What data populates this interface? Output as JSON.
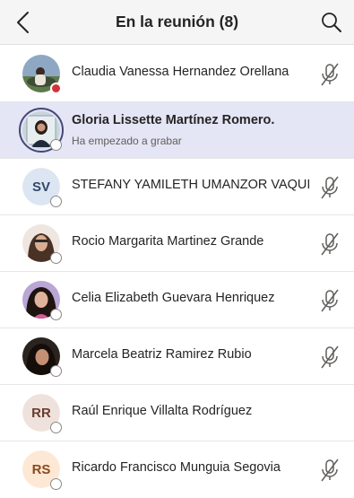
{
  "header": {
    "title": "En la reunión (8)",
    "back_icon": "chevron-left-icon",
    "search_icon": "search-icon"
  },
  "colors": {
    "header_bg": "#f5f5f5",
    "highlight_bg": "#e4e5f5",
    "busy": "#d13438",
    "presenter_ring": "#464775"
  },
  "participants": [
    {
      "name": "Claudia Vanessa  Hernandez Orellana",
      "avatar": "photo",
      "presence": "busy",
      "muted": true
    },
    {
      "name": "Gloria Lissette Martínez Romero.",
      "subtitle": "Ha empezado a grabar",
      "avatar": "photo",
      "presence": "offline",
      "muted": false,
      "highlighted": true
    },
    {
      "name": "STEFANY YAMILETH UMANZOR VAQUIZ",
      "initials": "SV",
      "avatar": "initials",
      "presence": "offline",
      "muted": true
    },
    {
      "name": "Rocio Margarita Martinez Grande",
      "avatar": "photo",
      "presence": "offline",
      "muted": true
    },
    {
      "name": "Celia Elizabeth Guevara Henriquez",
      "avatar": "photo",
      "presence": "offline",
      "muted": true
    },
    {
      "name": "Marcela Beatriz Ramirez Rubio",
      "avatar": "photo",
      "presence": "offline",
      "muted": true
    },
    {
      "name": "Raúl Enrique  Villalta Rodríguez",
      "initials": "RR",
      "avatar": "initials",
      "presence": "offline",
      "muted": false
    },
    {
      "name": "Ricardo Francisco Munguia Segovia",
      "initials": "RS",
      "avatar": "initials",
      "presence": "offline",
      "muted": true
    }
  ]
}
